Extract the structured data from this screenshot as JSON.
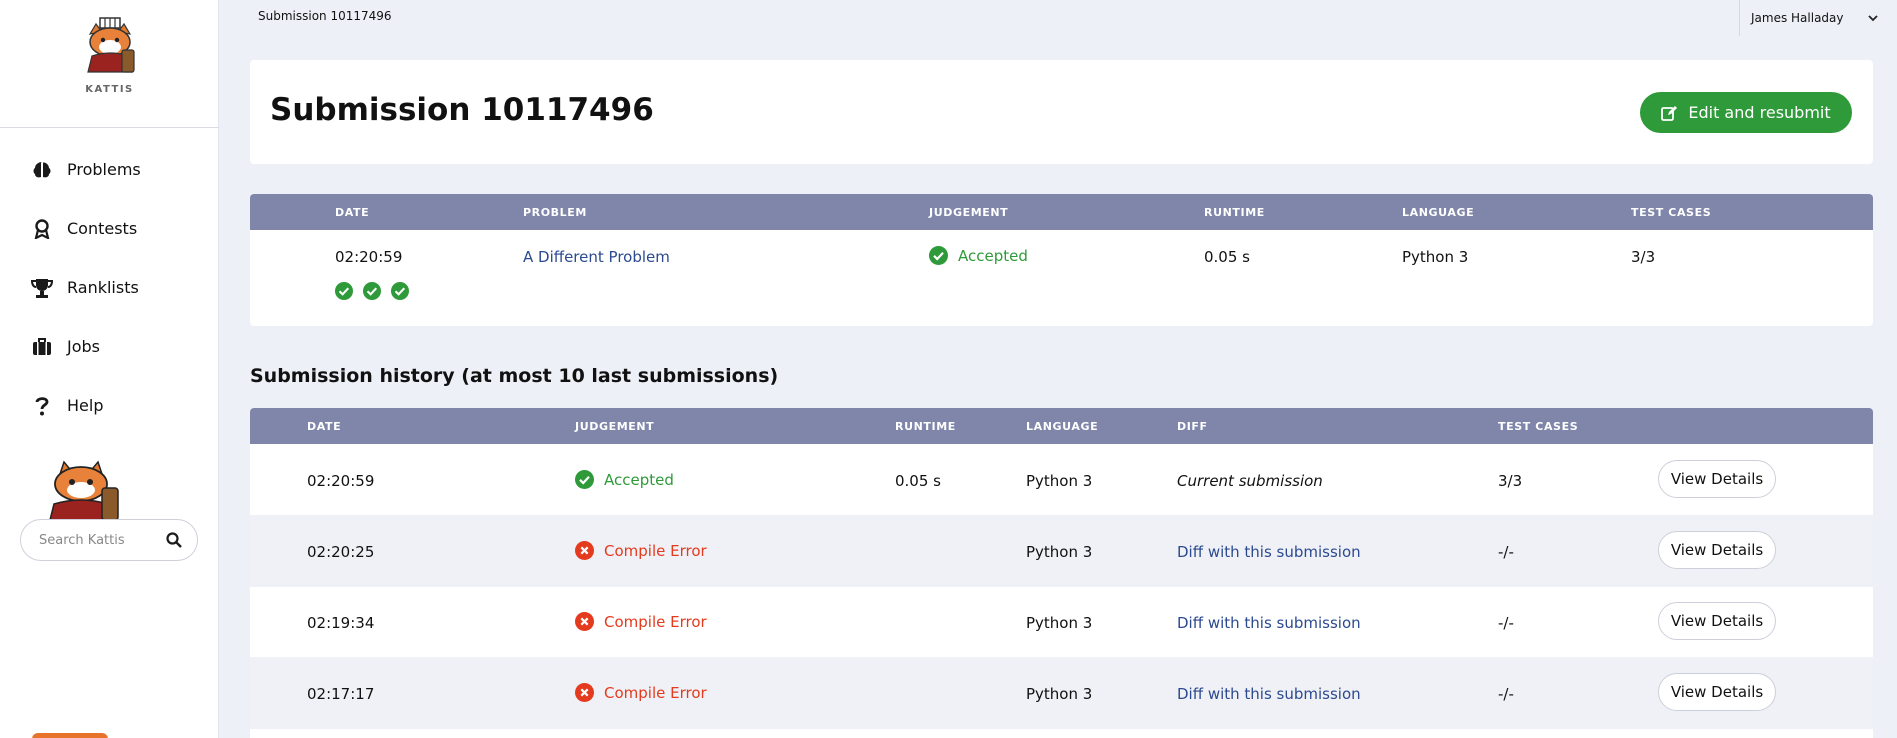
{
  "sidebar": {
    "logo_text": "KATTIS",
    "nav": [
      {
        "label": "Problems",
        "icon": "brain-icon"
      },
      {
        "label": "Contests",
        "icon": "award-icon"
      },
      {
        "label": "Ranklists",
        "icon": "trophy-icon"
      },
      {
        "label": "Jobs",
        "icon": "briefcase-icon"
      },
      {
        "label": "Help",
        "icon": "question-icon"
      }
    ],
    "search_placeholder": "Search Kattis"
  },
  "topbar": {
    "title": "Submission 10117496",
    "user": "James Halladay"
  },
  "header": {
    "title": "Submission 10117496",
    "edit_label": "Edit and resubmit"
  },
  "summary": {
    "headers": {
      "date": "DATE",
      "problem": "PROBLEM",
      "judgement": "JUDGEMENT",
      "runtime": "RUNTIME",
      "language": "LANGUAGE",
      "test_cases": "TEST CASES"
    },
    "date": "02:20:59",
    "problem": "A Different Problem",
    "judgement": "Accepted",
    "runtime": "0.05 s",
    "language": "Python 3",
    "test_cases": "3/3",
    "passed_tests": 3
  },
  "history": {
    "title": "Submission history (at most 10 last submissions)",
    "headers": {
      "date": "DATE",
      "judgement": "JUDGEMENT",
      "runtime": "RUNTIME",
      "language": "LANGUAGE",
      "diff": "DIFF",
      "test_cases": "TEST CASES"
    },
    "view_label": "View Details",
    "rows": [
      {
        "date": "02:20:59",
        "judgement": "Accepted",
        "runtime": "0.05 s",
        "language": "Python 3",
        "diff": "Current submission",
        "test_cases": "3/3"
      },
      {
        "date": "02:20:25",
        "judgement": "Compile Error",
        "runtime": "",
        "language": "Python 3",
        "diff": "Diff with this submission",
        "test_cases": "-/-"
      },
      {
        "date": "02:19:34",
        "judgement": "Compile Error",
        "runtime": "",
        "language": "Python 3",
        "diff": "Diff with this submission",
        "test_cases": "-/-"
      },
      {
        "date": "02:17:17",
        "judgement": "Compile Error",
        "runtime": "",
        "language": "Python 3",
        "diff": "Diff with this submission",
        "test_cases": "-/-"
      }
    ]
  },
  "colors": {
    "accent_green": "#2e9a39",
    "error_red": "#e43a1d",
    "table_header": "#7f86aa",
    "link_blue": "#2b4a8f"
  }
}
